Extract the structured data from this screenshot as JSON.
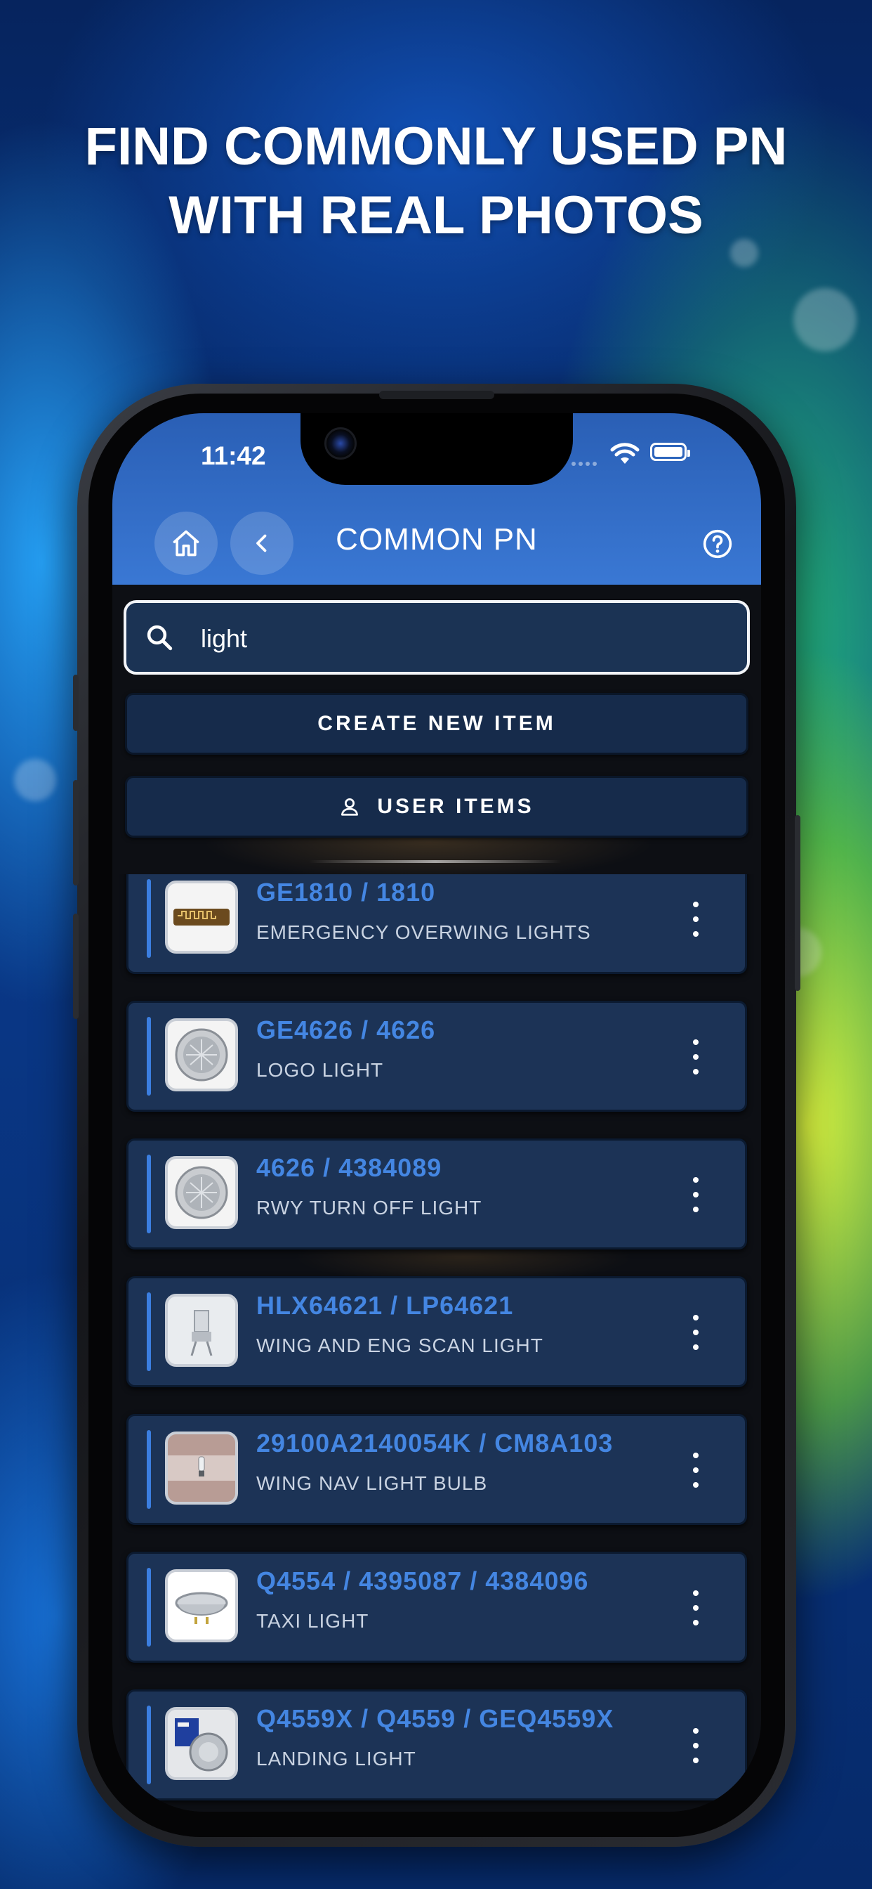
{
  "headline": {
    "line1": "FIND COMMONLY USED PN",
    "line2": "WITH REAL PHOTOS"
  },
  "status_bar": {
    "time": "11:42"
  },
  "header": {
    "title": "COMMON PN"
  },
  "search": {
    "value": "light"
  },
  "buttons": {
    "create_new_item": "CREATE NEW ITEM",
    "user_items": "USER ITEMS"
  },
  "items": [
    {
      "pn": "GE1810 / 1810",
      "description": "EMERGENCY OVERWING LIGHTS",
      "photo": "strip-lamp"
    },
    {
      "pn": "GE4626 / 4626",
      "description": "LOGO LIGHT",
      "photo": "sealed-beam"
    },
    {
      "pn": "4626 / 4384089",
      "description": "RWY TURN OFF LIGHT",
      "photo": "sealed-beam"
    },
    {
      "pn": "HLX64621 / LP64621",
      "description": "WING AND ENG SCAN LIGHT",
      "photo": "halogen-bulb"
    },
    {
      "pn": "29100A2140054K / CM8A103",
      "description": "WING NAV LIGHT BULB",
      "photo": "small-bulb"
    },
    {
      "pn": "Q4554 / 4395087 / 4384096",
      "description": "TAXI LIGHT",
      "photo": "par-lamp"
    },
    {
      "pn": "Q4559X / Q4559 / GEQ4559X",
      "description": "LANDING LIGHT",
      "photo": "boxed-lamp"
    }
  ]
}
